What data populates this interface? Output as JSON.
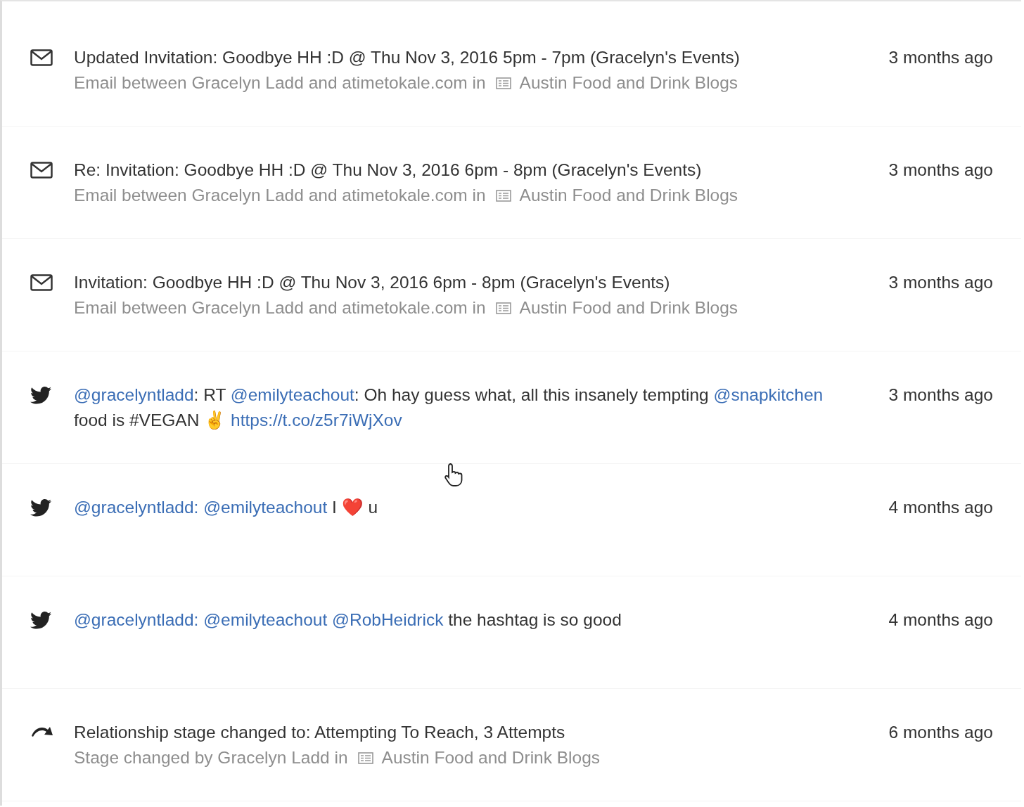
{
  "activities": [
    {
      "kind": "email",
      "title": "Updated Invitation: Goodbye HH :D @ Thu Nov 3, 2016 5pm - 7pm (Gracelyn's Events)",
      "detail": "Email between Gracelyn Ladd and atimetokale.com in",
      "list": "Austin Food and Drink Blogs",
      "time": "3 months ago"
    },
    {
      "kind": "email",
      "title": "Re: Invitation: Goodbye HH :D @ Thu Nov 3, 2016 6pm - 8pm (Gracelyn's Events)",
      "detail": "Email between Gracelyn Ladd and atimetokale.com in",
      "list": "Austin Food and Drink Blogs",
      "time": "3 months ago"
    },
    {
      "kind": "email",
      "title": "Invitation: Goodbye HH :D @ Thu Nov 3, 2016 6pm - 8pm (Gracelyn's Events)",
      "detail": "Email between Gracelyn Ladd and atimetokale.com in",
      "list": "Austin Food and Drink Blogs",
      "time": "3 months ago"
    },
    {
      "kind": "tweet",
      "segments": [
        {
          "kind": "mention",
          "text": "@gracelyntladd"
        },
        {
          "kind": "plain",
          "text": ": RT "
        },
        {
          "kind": "mention",
          "text": "@emilyteachout"
        },
        {
          "kind": "plain",
          "text": ": Oh hay guess what, all this insanely tempting "
        },
        {
          "kind": "mention",
          "text": "@snapkitchen"
        },
        {
          "kind": "plain",
          "text": " food is #VEGAN ✌️ "
        },
        {
          "kind": "link",
          "text": "https://t.co/z5r7iWjXov"
        }
      ],
      "time": "3 months ago"
    },
    {
      "kind": "tweet",
      "segments": [
        {
          "kind": "mention",
          "text": "@gracelyntladd:"
        },
        {
          "kind": "mention",
          "text": "@emilyteachout"
        },
        {
          "kind": "plain",
          "text": " I ❤️ u"
        }
      ],
      "time": "4 months ago"
    },
    {
      "kind": "tweet",
      "segments": [
        {
          "kind": "mention",
          "text": "@gracelyntladd:"
        },
        {
          "kind": "mention",
          "text": "@emilyteachout"
        },
        {
          "kind": "mention",
          "text": "@RobHeidrick"
        },
        {
          "kind": "plain",
          "text": " the hashtag is so good"
        }
      ],
      "time": "4 months ago"
    },
    {
      "kind": "stage",
      "title": "Relationship stage changed to: Attempting To Reach, 3 Attempts",
      "detail": "Stage changed by Gracelyn Ladd in",
      "list": "Austin Food and Drink Blogs",
      "time": "6 months ago"
    }
  ]
}
